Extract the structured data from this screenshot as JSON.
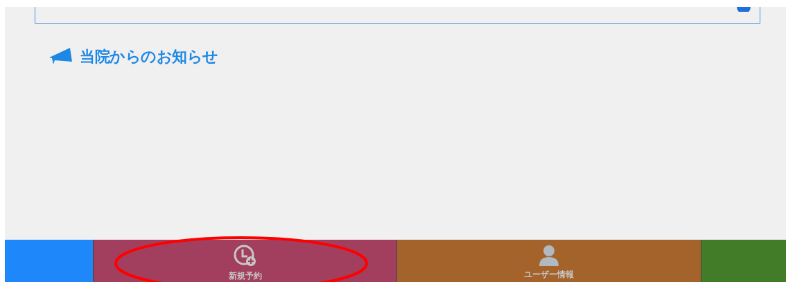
{
  "notice_section": {
    "title": "当院からのお知らせ"
  },
  "bottom_nav": [
    {
      "kind": "blank",
      "color": "#1e88fa",
      "circled": false
    },
    {
      "kind": "clock",
      "label": "新規予約",
      "color": "#a23f5e",
      "circled": true
    },
    {
      "kind": "user",
      "label": "ユーザー情報",
      "color": "#a3632a",
      "circled": false
    },
    {
      "kind": "blank",
      "color": "#437c29",
      "circled": false
    }
  ]
}
